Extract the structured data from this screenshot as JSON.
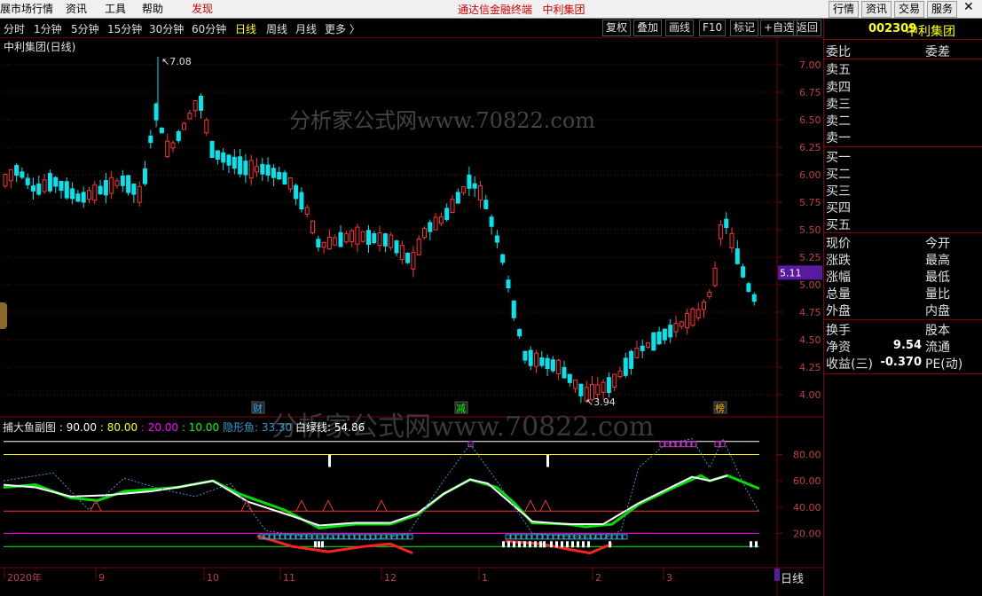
{
  "menu": {
    "items": [
      "展市场行情",
      "资讯",
      "工具",
      "帮助"
    ],
    "discover": "发现",
    "brand": "通达信金融终端",
    "stock_name_top": "中利集团",
    "right": [
      "行情",
      "资讯",
      "交易",
      "服务"
    ]
  },
  "toolbar": {
    "periods": [
      "分时",
      "1分钟",
      "5分钟",
      "15分钟",
      "30分钟",
      "60分钟",
      "日线",
      "周线",
      "月线",
      "更多 〉"
    ],
    "active_period": "日线",
    "buttons": [
      "复权",
      "叠加",
      "画线",
      "F10",
      "标记",
      "+自选",
      "返回"
    ]
  },
  "chart": {
    "title": "中利集团(日线)",
    "high_label": "7.08",
    "low_label": "3.94",
    "current_price_tag": "5.11",
    "price_axis": [
      "7.00",
      "6.75",
      "6.50",
      "6.25",
      "6.00",
      "5.75",
      "5.50",
      "5.25",
      "5.00",
      "4.75",
      "4.50",
      "4.25",
      "4.00"
    ],
    "markers": [
      "财",
      "减",
      "榜"
    ],
    "watermark": "分析家公式网www.70822.com"
  },
  "indicator": {
    "name": "捕大鱼副图",
    "params": [
      {
        "text": ": 90.00",
        "color": "#ffffff"
      },
      {
        "text": ": 80.00",
        "color": "#ffff00"
      },
      {
        "text": ": 20.00",
        "color": "#ff00ff"
      },
      {
        "text": ": 10.00",
        "color": "#00ff00"
      },
      {
        "text": "隐形鱼: 33.30",
        "color": "#3399cc"
      },
      {
        "text": "白绿线: 54.86",
        "color": "#ffffff"
      }
    ],
    "axis": [
      "80.00",
      "60.00",
      "40.00",
      "20.00"
    ]
  },
  "date_axis": [
    "2020年",
    "9",
    "10",
    "11",
    "12",
    "1",
    "2",
    "3"
  ],
  "bottom_period": "日线",
  "panel": {
    "code": "002309",
    "name": "中利集团",
    "header": [
      "委比",
      "委差"
    ],
    "sell": [
      "卖五",
      "卖四",
      "卖三",
      "卖二",
      "卖一"
    ],
    "buy": [
      "买一",
      "买二",
      "买三",
      "买四",
      "买五"
    ],
    "quote_left": [
      "现价",
      "涨跌",
      "涨幅",
      "总量",
      "外盘"
    ],
    "quote_right": [
      "今开",
      "最高",
      "最低",
      "量比",
      "内盘"
    ],
    "extra_left": [
      "换手",
      "净资",
      "收益(三)"
    ],
    "extra_right": [
      "股本",
      "流通",
      "PE(动)"
    ],
    "net_asset_value": "9.54",
    "eps_value": "-0.370"
  },
  "colors": {
    "up": "#ff3232",
    "down": "#00e5ee",
    "accent": "#ffff00",
    "grid": "#800000"
  }
}
